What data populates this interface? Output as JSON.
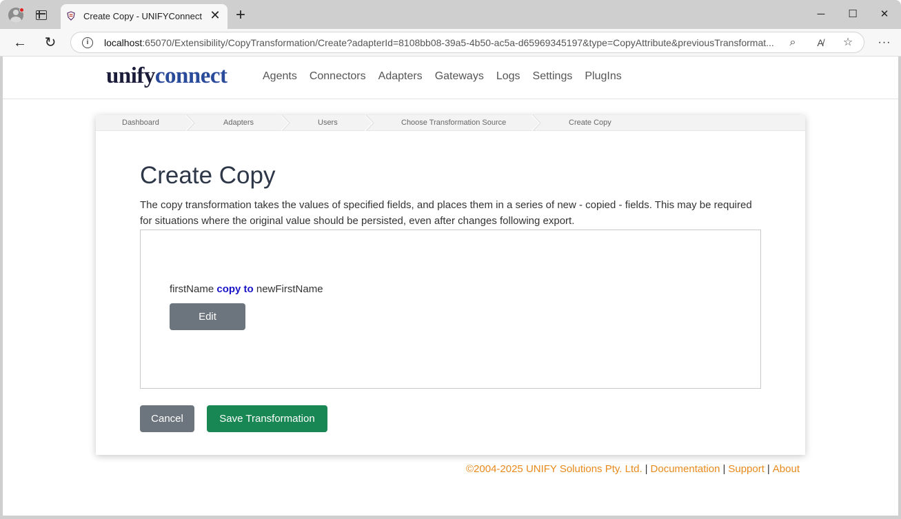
{
  "browser": {
    "tab_title": "Create Copy - UNIFYConnect",
    "url_host": "localhost",
    "url_rest": ":65070/Extensibility/CopyTransformation/Create?adapterId=8108bb08-39a5-4b50-ac5a-d65969345197&type=CopyAttribute&previousTransformat..."
  },
  "header": {
    "logo_part1": "unify",
    "logo_part2": "connect",
    "nav": [
      "Agents",
      "Connectors",
      "Adapters",
      "Gateways",
      "Logs",
      "Settings",
      "PlugIns"
    ]
  },
  "breadcrumb": [
    "Dashboard",
    "Adapters",
    "Users",
    "Choose Transformation Source",
    "Create Copy"
  ],
  "main": {
    "title": "Create Copy",
    "description": "The copy transformation takes the values of specified fields, and places them in a series of new - copied - fields. This may be required for situations where the original value should be persisted, even after changes following export.",
    "transformation": {
      "source": "firstName",
      "keyword": "copy to",
      "target": "newFirstName",
      "edit_label": "Edit"
    },
    "cancel_label": "Cancel",
    "save_label": "Save Transformation"
  },
  "footer": {
    "copyright": "©2004-2025 UNIFY Solutions Pty. Ltd.",
    "links": [
      "Documentation",
      "Support",
      "About"
    ]
  },
  "colors": {
    "save": "#198754",
    "secondary": "#6c757d",
    "footer_link": "#e8891c",
    "keyword": "#1a14c8"
  }
}
